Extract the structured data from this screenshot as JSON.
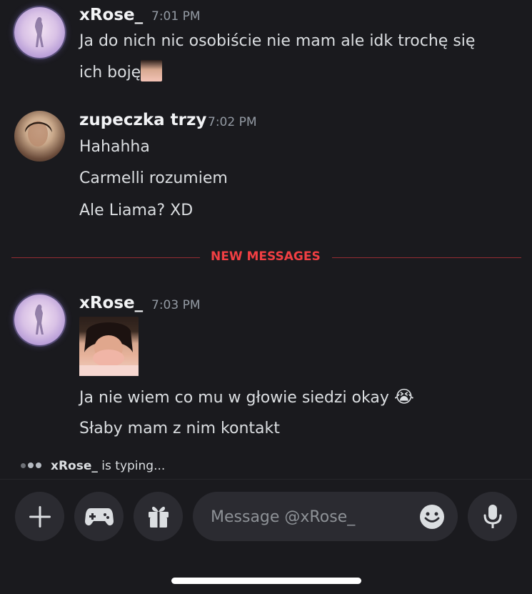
{
  "messages": [
    {
      "author": "xRose_",
      "time": "7:01 PM",
      "lines": [
        "Ja do nich nic osobiście nie mam ale idk trochę się",
        "ich boję"
      ]
    },
    {
      "author": "zupeczka trzy",
      "time": "7:02 PM",
      "lines": [
        "Hahahha",
        "Carmelli rozumiem",
        "Ale Liama? XD"
      ]
    },
    {
      "author": "xRose_",
      "time": "7:03 PM",
      "lines": [
        "Ja nie wiem co mu w głowie siedzi okay",
        "Słaby mam z nim kontakt"
      ],
      "emoji": "😭"
    }
  ],
  "divider": {
    "label": "NEW MESSAGES"
  },
  "typing": {
    "user": "xRose_",
    "suffix": " is typing..."
  },
  "composer": {
    "placeholder": "Message @xRose_"
  },
  "icons": {
    "add": "plus-icon",
    "games": "gamepad-icon",
    "gift": "gift-icon",
    "emoji": "smiley-icon",
    "voice": "microphone-icon"
  },
  "colors": {
    "background": "#1a1a1e",
    "new_messages": "#f23f43",
    "button_bg": "#2b2b31"
  }
}
